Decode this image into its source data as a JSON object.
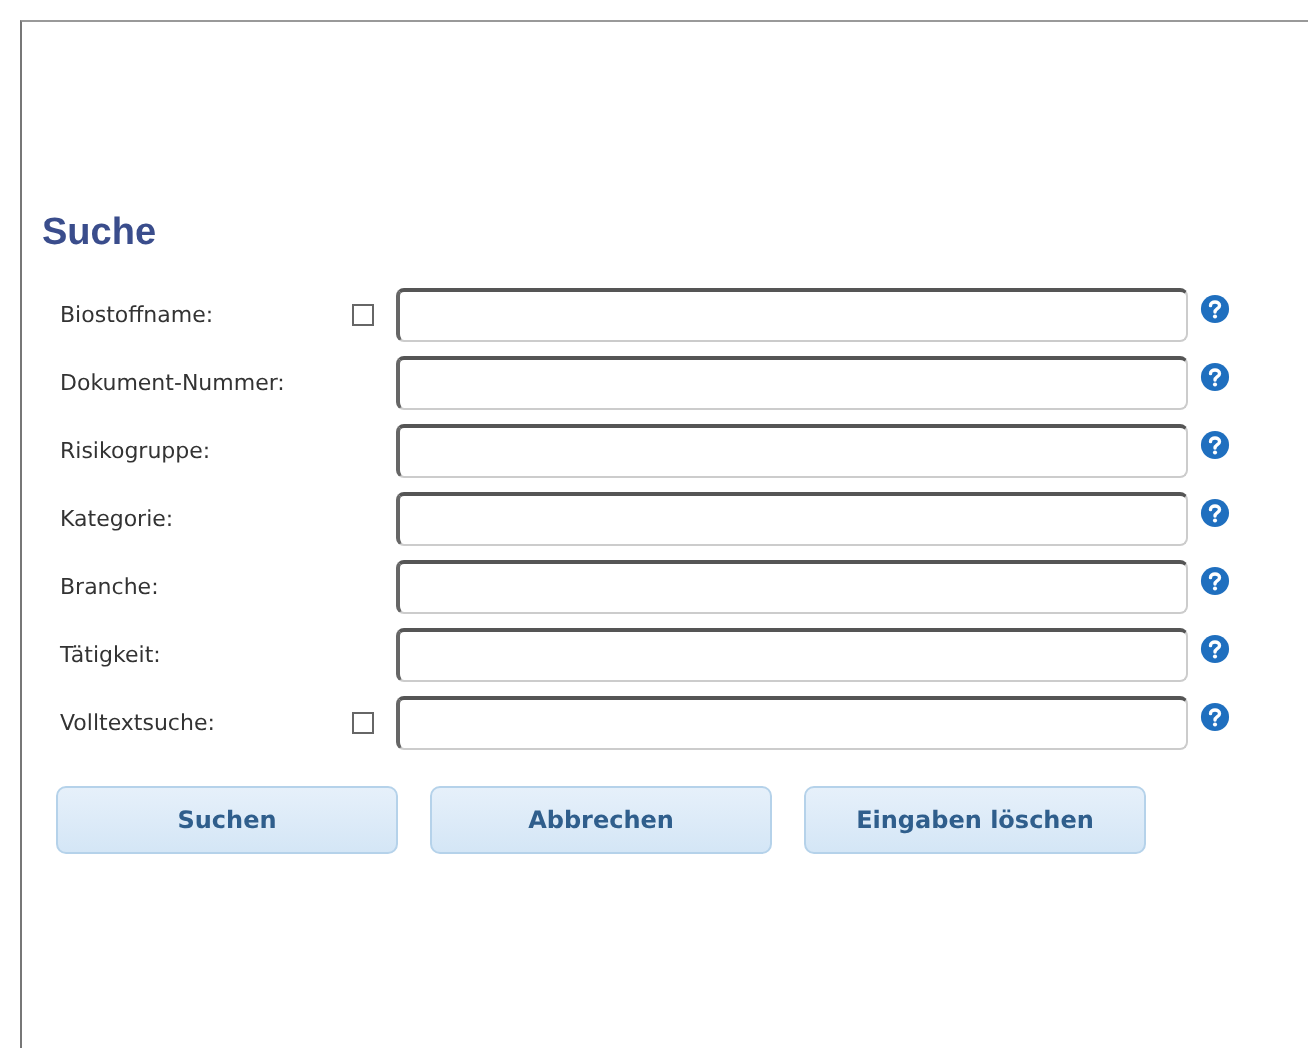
{
  "title": "Suche",
  "fields": [
    {
      "label": "Biostoffname:",
      "checkbox": {
        "checked": false
      }
    },
    {
      "label": "Dokument-Nummer:"
    },
    {
      "label": "Risikogruppe:"
    },
    {
      "label": "Kategorie:"
    },
    {
      "label": "Branche:"
    },
    {
      "label": "Tätigkeit:"
    },
    {
      "label": "Volltextsuche:",
      "checkbox": {
        "checked": false
      }
    }
  ],
  "buttons": [
    "Suchen",
    "Abbrechen",
    "Eingaben löschen"
  ]
}
